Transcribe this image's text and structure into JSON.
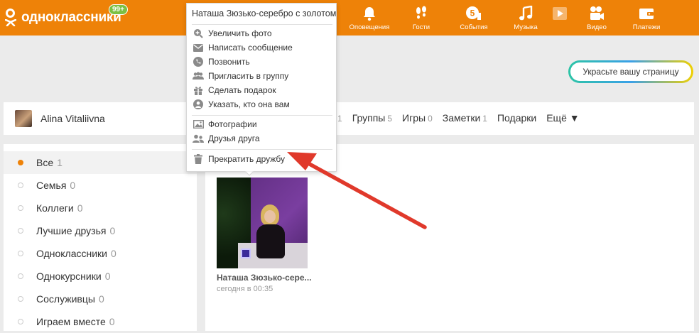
{
  "header": {
    "logo_text": "одноклассники",
    "badge": "99+",
    "nav": [
      {
        "label": "Оповещения",
        "icon": "bell-icon"
      },
      {
        "label": "Гости",
        "icon": "footprints-icon"
      },
      {
        "label": "События",
        "icon": "events-icon"
      },
      {
        "label": "Музыка",
        "icon": "music-icon"
      },
      {
        "label": "",
        "icon": "play-icon"
      },
      {
        "label": "Видео",
        "icon": "video-camera-icon"
      },
      {
        "label": "Платежи",
        "icon": "wallet-icon"
      }
    ],
    "accent_color": "#ee8208"
  },
  "decorate_button": "Украсьте вашу страницу",
  "profile": {
    "name": "Alina Vitaliivna",
    "tabs": [
      {
        "label": "Группы",
        "count": "5"
      },
      {
        "label": "Игры",
        "count": "0"
      },
      {
        "label": "Заметки",
        "count": "1"
      },
      {
        "label": "Подарки",
        "count": ""
      },
      {
        "label": "Ещё ▼",
        "count": ""
      }
    ],
    "partial_count": "1"
  },
  "sidebar": {
    "items": [
      {
        "label": "Все",
        "count": "1",
        "active": true
      },
      {
        "label": "Семья",
        "count": "0"
      },
      {
        "label": "Коллеги",
        "count": "0"
      },
      {
        "label": "Лучшие друзья",
        "count": "0"
      },
      {
        "label": "Одноклассники",
        "count": "0"
      },
      {
        "label": "Однокурсники",
        "count": "0"
      },
      {
        "label": "Сослуживцы",
        "count": "0"
      },
      {
        "label": "Играем вместе",
        "count": "0"
      }
    ]
  },
  "friend_card": {
    "name": "Наташа Зюзько-сере...",
    "time": "сегодня в 00:35"
  },
  "popup": {
    "title": "Наташа Зюзько-серебро с золотом",
    "group1": [
      {
        "label": "Увеличить фото",
        "icon": "zoom-in-icon"
      },
      {
        "label": "Написать сообщение",
        "icon": "envelope-icon"
      },
      {
        "label": "Позвонить",
        "icon": "phone-icon"
      },
      {
        "label": "Пригласить в группу",
        "icon": "group-icon"
      },
      {
        "label": "Сделать подарок",
        "icon": "gift-icon"
      },
      {
        "label": "Указать, кто она вам",
        "icon": "person-icon"
      }
    ],
    "group2": [
      {
        "label": "Фотографии",
        "icon": "image-icon"
      },
      {
        "label": "Друзья друга",
        "icon": "friends-icon"
      }
    ],
    "group3": [
      {
        "label": "Прекратить дружбу",
        "icon": "trash-icon"
      }
    ]
  },
  "annotation_arrow_color": "#e0392b"
}
